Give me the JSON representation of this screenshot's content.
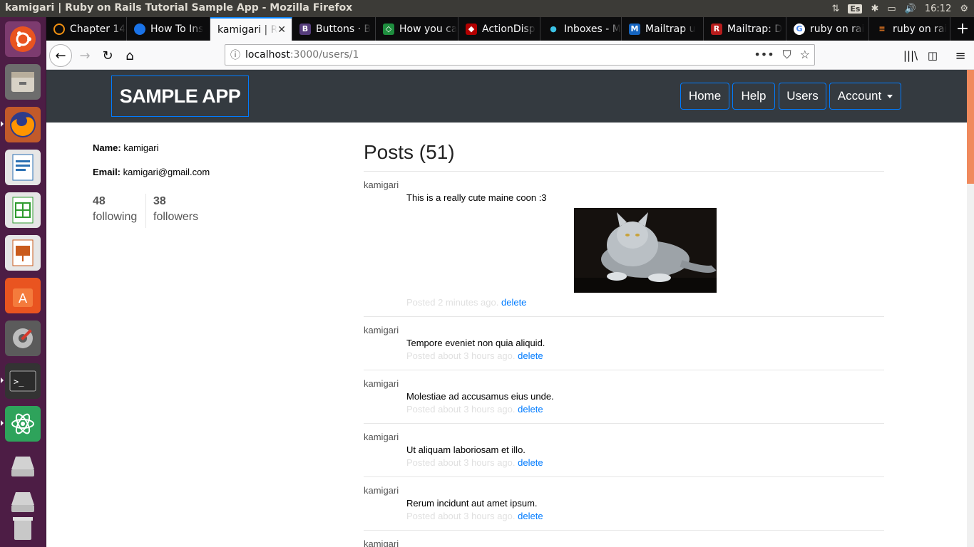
{
  "window_title": "kamigari | Ruby on Rails Tutorial Sample App - Mozilla Firefox",
  "system_tray": {
    "keyboard_layout": "Es",
    "clock": "16:12"
  },
  "browser": {
    "tabs": [
      {
        "label": "Chapter 14",
        "active": false
      },
      {
        "label": "How To Ins",
        "active": false
      },
      {
        "label": "kamigari | R",
        "active": true
      },
      {
        "label": "Buttons · B",
        "active": false
      },
      {
        "label": "How you ca",
        "active": false
      },
      {
        "label": "ActionDisp",
        "active": false
      },
      {
        "label": "Inboxes - M",
        "active": false
      },
      {
        "label": "Mailtrap u",
        "active": false
      },
      {
        "label": "Mailtrap: D",
        "active": false
      },
      {
        "label": "ruby on rai",
        "active": false
      },
      {
        "label": "ruby on rai",
        "active": false
      }
    ],
    "url_host": "localhost",
    "url_path": ":3000/users/1"
  },
  "site": {
    "logo": "SAMPLE APP",
    "nav": {
      "home": "Home",
      "help": "Help",
      "users": "Users",
      "account": "Account"
    }
  },
  "profile": {
    "name_label": "Name:",
    "name": "kamigari",
    "email_label": "Email:",
    "email": "kamigari@gmail.com",
    "following_count": "48",
    "following_label": "following",
    "followers_count": "38",
    "followers_label": "followers"
  },
  "posts": {
    "title": "Posts (51)",
    "delete_label": "delete",
    "items": [
      {
        "user": "kamigari",
        "content": "This is a really cute maine coon :3",
        "posted": "Posted 2 minutes ago.",
        "has_image": true
      },
      {
        "user": "kamigari",
        "content": "Tempore eveniet non quia aliquid.",
        "posted": "Posted about 3 hours ago."
      },
      {
        "user": "kamigari",
        "content": "Molestiae ad accusamus eius unde.",
        "posted": "Posted about 3 hours ago."
      },
      {
        "user": "kamigari",
        "content": "Ut aliquam laboriosam et illo.",
        "posted": "Posted about 3 hours ago."
      },
      {
        "user": "kamigari",
        "content": "Rerum incidunt aut amet ipsum.",
        "posted": "Posted about 3 hours ago."
      },
      {
        "user": "kamigari"
      }
    ]
  },
  "colors": {
    "header_bg": "#343a40",
    "accent": "#007bff",
    "launcher_bg": "#4d1d45",
    "scroll_thumb": "#f08a5d"
  }
}
